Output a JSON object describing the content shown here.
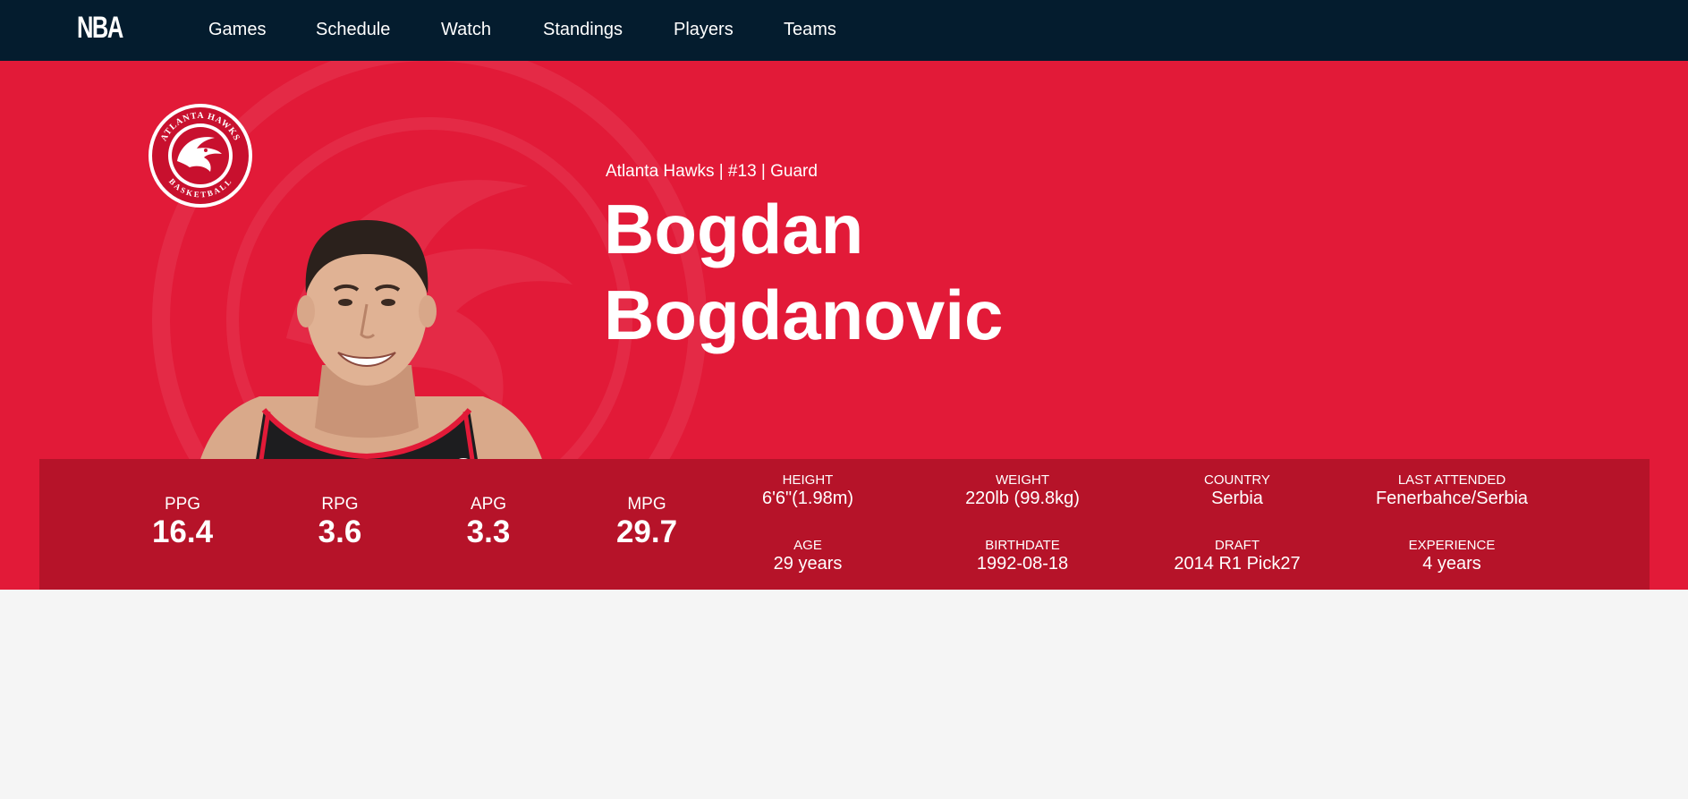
{
  "nav": {
    "logo_text": "NBA",
    "items": [
      {
        "label": "Games"
      },
      {
        "label": "Schedule"
      },
      {
        "label": "Watch"
      },
      {
        "label": "Standings"
      },
      {
        "label": "Players"
      },
      {
        "label": "Teams"
      }
    ]
  },
  "player": {
    "team_line": "Atlanta Hawks | #13 | Guard",
    "first_name": "Bogdan",
    "last_name": "Bogdanovic",
    "team_badge": {
      "top_text": "ATLANTA HAWKS",
      "bottom_text": "BASKETBALL"
    }
  },
  "stats": [
    {
      "label": "PPG",
      "value": "16.4"
    },
    {
      "label": "RPG",
      "value": "3.6"
    },
    {
      "label": "APG",
      "value": "3.3"
    },
    {
      "label": "MPG",
      "value": "29.7"
    }
  ],
  "info": [
    {
      "label": "HEIGHT",
      "value": "6'6\"(1.98m)"
    },
    {
      "label": "WEIGHT",
      "value": "220lb (99.8kg)"
    },
    {
      "label": "COUNTRY",
      "value": "Serbia"
    },
    {
      "label": "LAST ATTENDED",
      "value": "Fenerbahce/Serbia"
    },
    {
      "label": "AGE",
      "value": "29 years"
    },
    {
      "label": "BIRTHDATE",
      "value": "1992-08-18"
    },
    {
      "label": "DRAFT",
      "value": "2014 R1 Pick27"
    },
    {
      "label": "EXPERIENCE",
      "value": "4 years"
    }
  ],
  "colors": {
    "nav_bg": "#041c2e",
    "hero_bg": "#e21a38",
    "stats_bg": "#b61329",
    "page_bg": "#f5f5f5"
  },
  "icons": [
    "nba-logo-icon",
    "hawks-logo-icon",
    "player-headshot"
  ]
}
